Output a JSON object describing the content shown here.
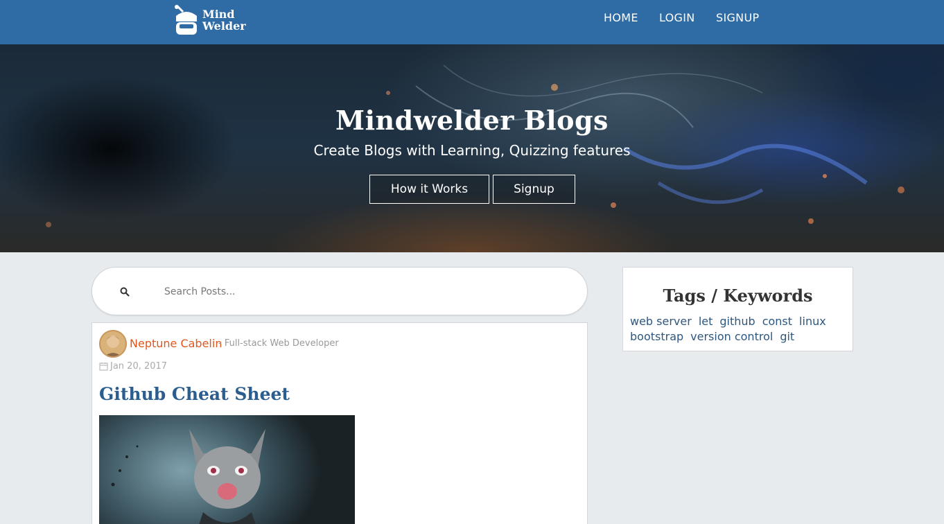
{
  "navbar": {
    "logo_line1": "Mind",
    "logo_line2": "Welder",
    "links": [
      {
        "label": "HOME"
      },
      {
        "label": "LOGIN"
      },
      {
        "label": "SIGNUP"
      }
    ],
    "bg_color": "#2f6ca6"
  },
  "hero": {
    "title": "Mindwelder Blogs",
    "subtitle": "Create Blogs with Learning, Quizzing features",
    "buttons": [
      {
        "label": "How it Works"
      },
      {
        "label": "Signup"
      }
    ]
  },
  "search": {
    "icon": "search-icon",
    "placeholder": "Search Posts..."
  },
  "post": {
    "author": "Neptune Cabelin",
    "role": "- Full-stack Web Developer",
    "date_icon": "calendar-icon",
    "date": "Jan 20, 2017",
    "title": "Github Cheat Sheet",
    "title_color": "#2b5e8e",
    "author_color": "#e0561b"
  },
  "tags": {
    "title": "Tags / Keywords",
    "row1": [
      "web server",
      "let",
      "github",
      "const",
      "linux"
    ],
    "row2": [
      "bootstrap",
      "version control",
      "git"
    ]
  }
}
